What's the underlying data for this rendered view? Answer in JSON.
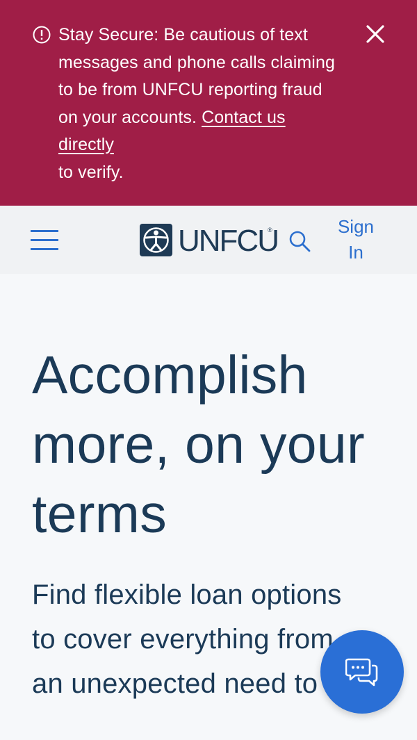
{
  "alert": {
    "icon": "info-circle-icon",
    "message": "Stay Secure: Be cautious of text messages and phone calls claiming to be from UNFCU reporting fraud on your accounts.",
    "link_text": "Contact us directly",
    "trailing_text": "to verify.",
    "close_icon": "close-icon",
    "bg_color": "#a01e47"
  },
  "header": {
    "menu_icon": "hamburger-menu-icon",
    "logo_text": "UNFCU",
    "logo_reg": "®",
    "search_icon": "search-icon",
    "signin_label": "Sign In",
    "accent_color": "#2c6fce"
  },
  "hero": {
    "title": "Accomplish more, on your terms",
    "subtitle": "Find flexible loan options to cover everything from an unexpected need to"
  },
  "chat": {
    "icon": "chat-bubbles-icon",
    "color": "#2a6fd6"
  }
}
